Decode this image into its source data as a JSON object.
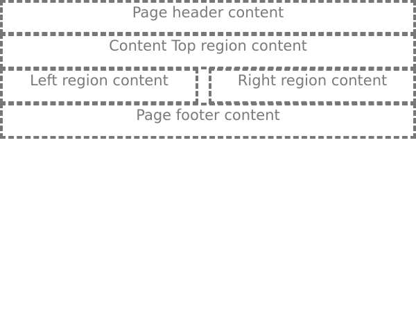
{
  "regions": {
    "header": "Page header content",
    "content_top": "Content Top region content",
    "left": "Left region content",
    "right": "Right region content",
    "footer": "Page footer content"
  }
}
